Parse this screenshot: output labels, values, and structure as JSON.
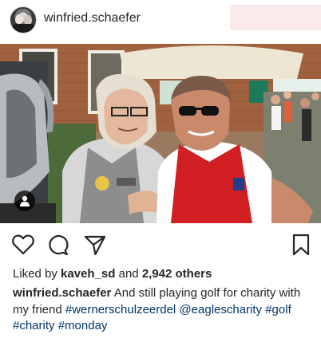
{
  "header": {
    "username": "winfried.schaefer"
  },
  "photo": {
    "alt_icon": "user-tag-icon"
  },
  "actions": {
    "icons": [
      "heart-icon",
      "comment-icon",
      "share-icon",
      "bookmark-icon"
    ]
  },
  "likes": {
    "prefix": "Liked by",
    "user": "kaveh_sd",
    "middle": "and",
    "count": "2,942 others"
  },
  "caption": {
    "username": "winfried.schaefer",
    "text": "And still playing golf for charity with my friend",
    "tags": [
      "#wernerschulzeerdel",
      "@eaglescharity",
      "#golf",
      "#charity",
      "#monday"
    ]
  },
  "colors": {
    "text": "#262626",
    "link": "#003569",
    "jersey_red": "#d11f24"
  }
}
